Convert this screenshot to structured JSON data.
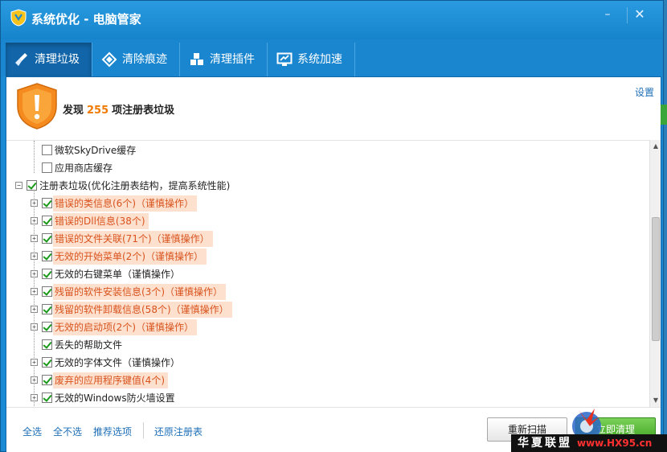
{
  "window": {
    "title": "系统优化 - 电脑管家",
    "minimize_glyph": "–",
    "close_glyph": "✕"
  },
  "tabs": [
    {
      "label": "清理垃圾",
      "icon": "broom-icon",
      "active": true
    },
    {
      "label": "清除痕迹",
      "icon": "eraser-icon",
      "active": false
    },
    {
      "label": "清理插件",
      "icon": "plugin-icon",
      "active": false
    },
    {
      "label": "系统加速",
      "icon": "monitor-speed-icon",
      "active": false
    }
  ],
  "header": {
    "prefix": "发现",
    "count": "255",
    "suffix": "项注册表垃圾",
    "settings_label": "设置"
  },
  "tree": {
    "rows": [
      {
        "label": "微软SkyDrive缓存",
        "checked": false,
        "warn": false
      },
      {
        "label": "应用商店缓存",
        "checked": false,
        "warn": false
      },
      {
        "label": "注册表垃圾(优化注册表结构，提高系统性能)",
        "checked": true,
        "warn": false,
        "expander": "−"
      },
      {
        "label": "错误的类信息(6个)（谨慎操作）",
        "checked": true,
        "warn": true,
        "expander": "+"
      },
      {
        "label": "错误的Dll信息(38个)",
        "checked": true,
        "warn": true,
        "expander": "+"
      },
      {
        "label": "错误的文件关联(71个)（谨慎操作）",
        "checked": true,
        "warn": true,
        "expander": "+"
      },
      {
        "label": "无效的开始菜单(2个)（谨慎操作）",
        "checked": true,
        "warn": true,
        "expander": "+"
      },
      {
        "label": "无效的右键菜单（谨慎操作）",
        "checked": true,
        "warn": false,
        "expander": "+"
      },
      {
        "label": "残留的软件安装信息(3个)（谨慎操作）",
        "checked": true,
        "warn": true,
        "expander": "+"
      },
      {
        "label": "残留的软件卸载信息(58个)（谨慎操作）",
        "checked": true,
        "warn": true,
        "expander": "+"
      },
      {
        "label": "无效的启动项(2个)（谨慎操作）",
        "checked": true,
        "warn": true,
        "expander": "+"
      },
      {
        "label": "丢失的帮助文件",
        "checked": true,
        "warn": false,
        "expander": ""
      },
      {
        "label": "无效的字体文件（谨慎操作）",
        "checked": true,
        "warn": false,
        "expander": "+"
      },
      {
        "label": "废弃的应用程序键值(4个)",
        "checked": true,
        "warn": true,
        "expander": "+"
      },
      {
        "label": "无效的Windows防火墙设置",
        "checked": true,
        "warn": false,
        "expander": "+"
      }
    ]
  },
  "footer": {
    "select_all": "全选",
    "select_none": "全不选",
    "recommended": "推荐选项",
    "restore_registry": "还原注册表",
    "rescan": "重新扫描",
    "clean_now": "立即清理"
  },
  "watermark": {
    "text": "华夏联盟",
    "site": "www.HX95.cn"
  },
  "colors": {
    "accent_blue": "#1a86cf",
    "warn_text": "#d9531e",
    "warn_bg": "#fde0cd",
    "count_orange": "#f07a00"
  }
}
